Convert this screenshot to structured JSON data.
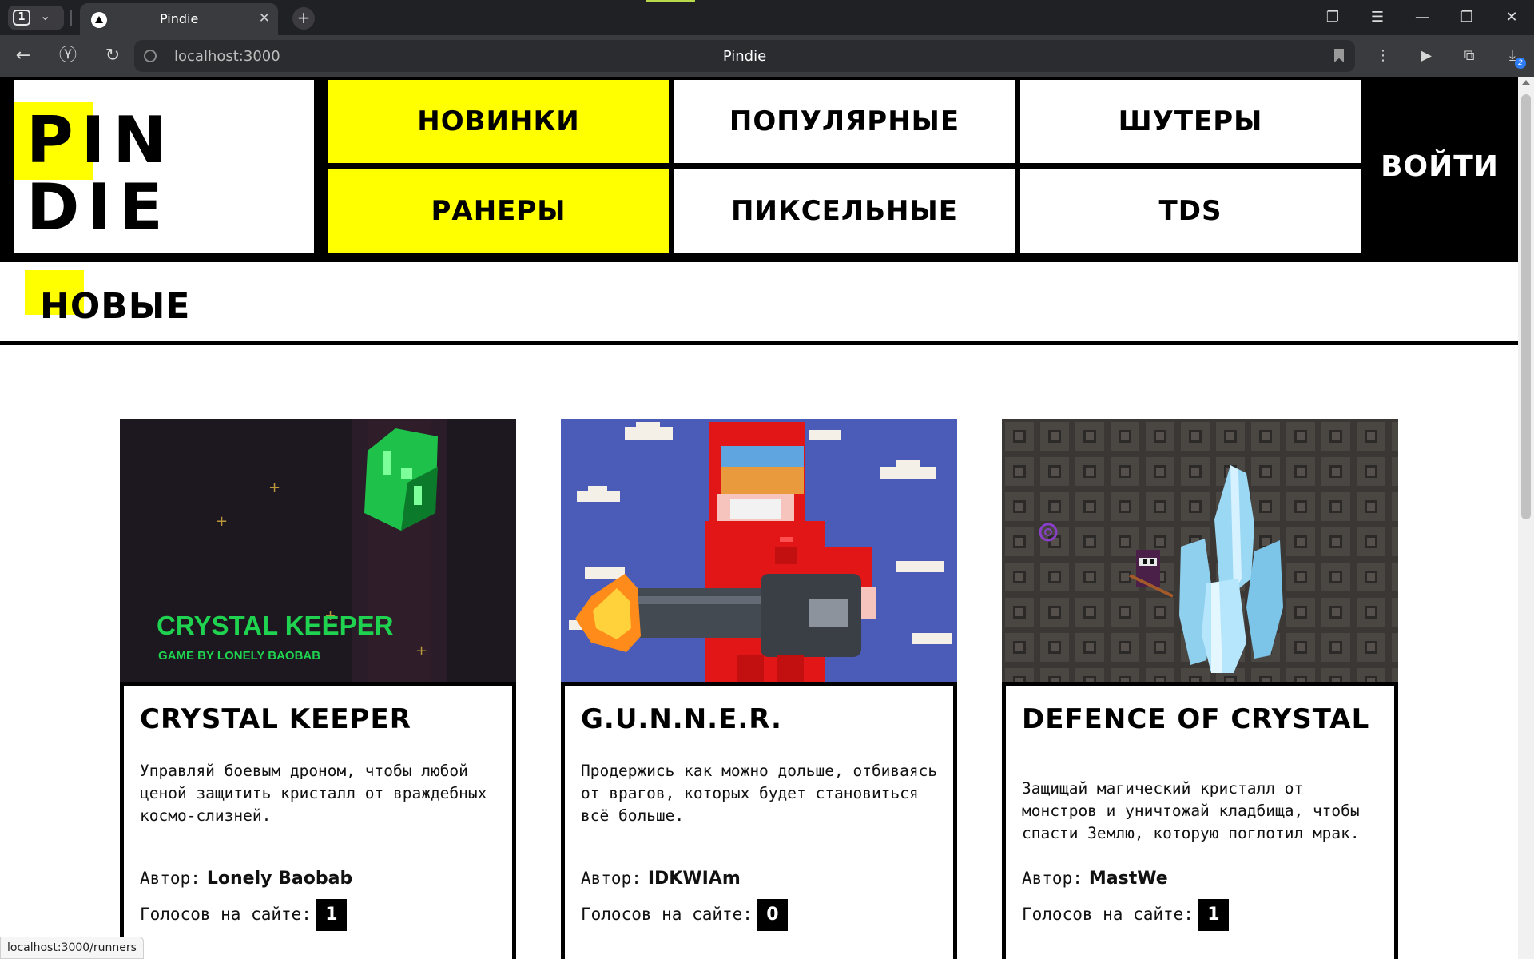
{
  "browser": {
    "tab_count": "1",
    "tab_title": "Pindie",
    "url": "localhost:3000",
    "page_title": "Pindie",
    "downloads_count": "2",
    "status_url": "localhost:3000/runners"
  },
  "header": {
    "logo_line1": "PIN",
    "logo_line2": "DIE",
    "menu": [
      {
        "label": "НОВИНКИ",
        "active": true
      },
      {
        "label": "ПОПУЛЯРНЫЕ",
        "active": false
      },
      {
        "label": "ШУТЕРЫ",
        "active": false
      },
      {
        "label": "РАНЕРЫ",
        "active": true
      },
      {
        "label": "ПИКСЕЛЬНЫЕ",
        "active": false
      },
      {
        "label": "TDS",
        "active": false
      }
    ],
    "login": "ВОЙТИ"
  },
  "section": {
    "title": "НОВЫЕ"
  },
  "colors": {
    "accent": "#ffff00",
    "dark": "#000000"
  },
  "author_label": "Автор:",
  "votes_label": "Голосов на сайте:",
  "cards": [
    {
      "title": "CRYSTAL KEEPER",
      "image_title": "CRYSTAL KEEPER",
      "image_subtitle": "GAME BY LONELY BAOBAB",
      "description": "Управляй боевым дроном, чтобы любой ценой защитить кристалл от враждебных космо-слизней.",
      "author": "Lonely Baobab",
      "votes": "1"
    },
    {
      "title": "G.U.N.N.E.R.",
      "description": "Продержись как можно дольше, отбиваясь от врагов, которых будет становиться всё больше.",
      "author": "IDKWIAm",
      "votes": "0"
    },
    {
      "title": "DEFENCE OF CRYSTAL",
      "description": "Защищай магический кристалл от монстров и уничтожай кладбища, чтобы спасти Землю, которую поглотил мрак.",
      "author": "MastWe",
      "votes": "1"
    }
  ]
}
